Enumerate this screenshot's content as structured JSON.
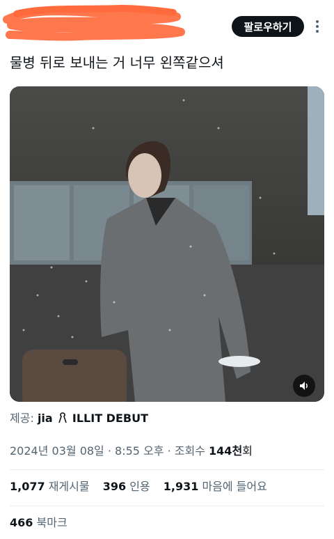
{
  "header": {
    "follow_label": "팔로우하기"
  },
  "tweet": {
    "text": "물병 뒤로 보내는 거 너무 왼쪽같으셔"
  },
  "source": {
    "label": "제공:",
    "name": "jia",
    "tagline": "ILLIT DEBUT"
  },
  "meta": {
    "date": "2024년 03월 08일",
    "sep1": " · ",
    "time": "8:55 오후",
    "sep2": " · ",
    "views_label": "조회수 ",
    "views_num": "144",
    "views_unit": "천",
    "views_suffix": "회"
  },
  "stats": {
    "retweets_num": "1,077",
    "retweets_label": "재게시물",
    "quotes_num": "396",
    "quotes_label": "인용",
    "likes_num": "1,931",
    "likes_label": "마음에 들어요"
  },
  "bookmarks": {
    "num": "466",
    "label": "북마크"
  },
  "colors": {
    "redaction": "#ff6b3d",
    "follow_bg": "#0f1419",
    "secondary_text": "#536471"
  }
}
